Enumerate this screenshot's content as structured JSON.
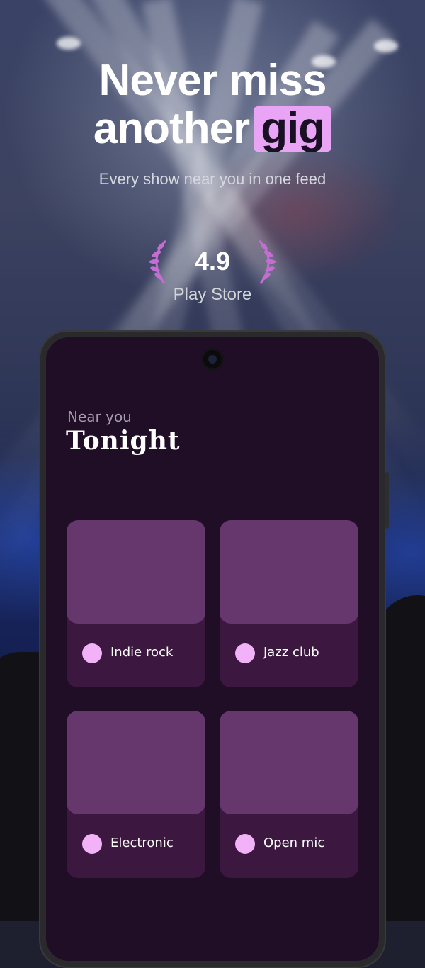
{
  "headline": {
    "line1": "Never miss",
    "line2_prefix": "another",
    "highlight": "gig"
  },
  "subtitle": "Every show near you in one feed",
  "rating": {
    "value": "4.9",
    "source": "Play Store"
  },
  "screen": {
    "eyebrow": "Near you",
    "title": "Tonight",
    "cards": [
      {
        "label": "Indie rock"
      },
      {
        "label": "Jazz club"
      },
      {
        "label": "Electronic"
      },
      {
        "label": "Open mic"
      }
    ]
  },
  "colors": {
    "accent": "#e9a4f5",
    "screen_bg": "#1f0e25",
    "card_bg": "#3c1740",
    "card_image": "#65376d",
    "dot": "#f1b2f7"
  },
  "icons": [
    "laurel-left-icon",
    "laurel-right-icon",
    "camera-icon"
  ]
}
